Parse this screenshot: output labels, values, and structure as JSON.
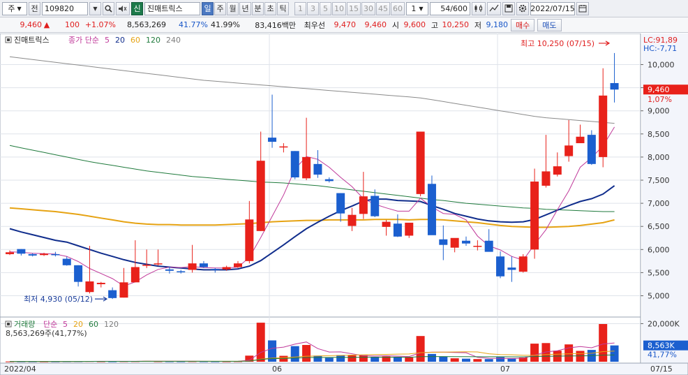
{
  "toolbar": {
    "market": "주",
    "type": "전",
    "code": "109820",
    "badge": "신",
    "name": "진매트릭스",
    "periods": [
      "일",
      "주",
      "월",
      "년",
      "분",
      "초",
      "틱"
    ],
    "active_period": "일",
    "intervals": [
      "1",
      "3",
      "5",
      "10",
      "15",
      "30",
      "45",
      "60"
    ],
    "custom_interval": "1",
    "count": "54/600",
    "date": "2022/07/15"
  },
  "quote": {
    "price": "9,460",
    "arrow": "▲",
    "change": "100",
    "change_pct": "+1.07%",
    "volume": "8,563,269",
    "vol_ratio": "41.77%",
    "turnover": "41.99%",
    "amount": "83,416백만",
    "best_label": "최우선",
    "ask": "9,470",
    "bid": "9,460",
    "open_label": "시",
    "open": "9,600",
    "high_label": "고",
    "high": "10,250",
    "low_label": "저",
    "low": "9,180",
    "buy_label": "매수",
    "sell_label": "매도"
  },
  "legend_price": {
    "name": "진매트릭스",
    "indicator": "종가 단순",
    "ma": [
      {
        "label": "5",
        "color": "#c0399a"
      },
      {
        "label": "20",
        "color": "#102d8c"
      },
      {
        "label": "60",
        "color": "#e6a313"
      },
      {
        "label": "120",
        "color": "#1f7a3c"
      },
      {
        "label": "240",
        "color": "#7d7d7d"
      }
    ]
  },
  "legend_volume": {
    "name": "거래량",
    "indicator": "단순",
    "ma": [
      {
        "label": "5",
        "color": "#c0399a"
      },
      {
        "label": "20",
        "color": "#e6a313"
      },
      {
        "label": "60",
        "color": "#1f7a3c"
      },
      {
        "label": "120",
        "color": "#7d7d7d"
      }
    ],
    "current": "8,563,269주(41,77%)"
  },
  "right_info": {
    "lc": "LC:91,89",
    "hc": "HC:-7,71",
    "price_tag": "9,460",
    "pct_tag": "1,07%",
    "vol_tag": "8,563K",
    "vol_pct": "41,77%"
  },
  "annotations": {
    "high": "최고 10,250 (07/15)",
    "low": "최저 4,930 (05/12)"
  },
  "colors": {
    "up": "#e8211a",
    "down": "#1b5fcf",
    "grid": "#dfe3ea",
    "panel_bg": "#ffffff"
  },
  "chart_data": {
    "type": "candlestick",
    "price_axis": {
      "min": 4600,
      "max": 10400,
      "ticks": [
        5000,
        5500,
        6000,
        6500,
        7000,
        7500,
        8000,
        8500,
        9000,
        9500,
        10000
      ],
      "tick_labels": [
        "5,000",
        "5,500",
        "6,000",
        "6,500",
        "7,000",
        "7,500",
        "8,000",
        "8,500",
        "9,000",
        "9,500",
        "10,000"
      ]
    },
    "volume_axis": {
      "max": 22000,
      "ticks": [
        20000
      ],
      "tick_labels": [
        "20,000K"
      ]
    },
    "x_labels": [
      {
        "index": 0,
        "label": "2022/04"
      },
      {
        "index": 23,
        "label": "06"
      },
      {
        "index": 43,
        "label": "07"
      }
    ],
    "last_label": "07/15",
    "ohlc": [
      [
        5900,
        5980,
        5880,
        5940
      ],
      [
        6010,
        6010,
        5870,
        5910
      ],
      [
        5900,
        5920,
        5850,
        5870
      ],
      [
        5880,
        5930,
        5860,
        5910
      ],
      [
        5900,
        5950,
        5850,
        5880
      ],
      [
        5800,
        5850,
        5650,
        5660
      ],
      [
        5660,
        5660,
        5200,
        5300
      ],
      [
        5080,
        6080,
        5050,
        5310
      ],
      [
        5250,
        5300,
        5180,
        5280
      ],
      [
        5120,
        5180,
        4930,
        4950
      ],
      [
        4960,
        5600,
        4960,
        5290
      ],
      [
        5290,
        6200,
        5290,
        5620
      ],
      [
        5650,
        6000,
        5600,
        5670
      ],
      [
        5680,
        6000,
        5650,
        5700
      ],
      [
        5570,
        5630,
        5480,
        5540
      ],
      [
        5530,
        5560,
        5480,
        5520
      ],
      [
        5560,
        6100,
        5500,
        5700
      ],
      [
        5700,
        5750,
        5600,
        5620
      ],
      [
        5580,
        5600,
        5500,
        5560
      ],
      [
        5570,
        5650,
        5540,
        5620
      ],
      [
        5620,
        5750,
        5600,
        5700
      ],
      [
        5750,
        7050,
        5700,
        6650
      ],
      [
        6400,
        8550,
        6400,
        7920
      ],
      [
        8420,
        9350,
        8200,
        8330
      ],
      [
        8230,
        8300,
        8100,
        8230
      ],
      [
        8130,
        8130,
        7520,
        7560
      ],
      [
        7540,
        8850,
        7500,
        8000
      ],
      [
        7850,
        8150,
        7550,
        7620
      ],
      [
        7520,
        7560,
        7450,
        7480
      ],
      [
        7220,
        7220,
        6600,
        6780
      ],
      [
        6510,
        6900,
        6400,
        6750
      ],
      [
        6770,
        7680,
        6660,
        7150
      ],
      [
        7160,
        7300,
        6700,
        6720
      ],
      [
        6490,
        6640,
        6300,
        6600
      ],
      [
        6560,
        6760,
        6270,
        6280
      ],
      [
        6300,
        6560,
        6250,
        6580
      ],
      [
        7200,
        8550,
        7150,
        8550
      ],
      [
        7420,
        7600,
        6320,
        6310
      ],
      [
        6220,
        6520,
        5770,
        6100
      ],
      [
        6040,
        6240,
        5940,
        6250
      ],
      [
        6190,
        6280,
        6080,
        6130
      ],
      [
        6060,
        6200,
        5980,
        6080
      ],
      [
        6190,
        6440,
        6050,
        5950
      ],
      [
        5850,
        5960,
        5380,
        5420
      ],
      [
        5610,
        5850,
        5300,
        5560
      ],
      [
        5520,
        5900,
        5500,
        5850
      ],
      [
        6000,
        7750,
        5800,
        7470
      ],
      [
        7380,
        8480,
        7340,
        7690
      ],
      [
        7620,
        8100,
        7580,
        7800
      ],
      [
        8020,
        8800,
        7900,
        8250
      ],
      [
        8300,
        8700,
        8300,
        8440
      ],
      [
        8480,
        8580,
        7830,
        7850
      ],
      [
        8000,
        9920,
        7780,
        9330
      ],
      [
        9600,
        10250,
        9180,
        9460
      ]
    ],
    "volume": [
      150,
      140,
      130,
      120,
      130,
      180,
      220,
      300,
      200,
      180,
      250,
      260,
      400,
      220,
      200,
      180,
      240,
      200,
      180,
      190,
      230,
      3200,
      20500,
      11200,
      3100,
      8200,
      8800,
      3200,
      2100,
      3500,
      3300,
      3400,
      2600,
      2800,
      2600,
      2200,
      13500,
      4100,
      2700,
      1800,
      1600,
      1400,
      1400,
      2400,
      1700,
      2200,
      9500,
      9800,
      5800,
      9100,
      5700,
      6200,
      19800,
      8560
    ],
    "ma": {
      "5": [
        5950,
        5940,
        5920,
        5910,
        5900,
        5850,
        5740,
        5590,
        5480,
        5370,
        5210,
        5300,
        5450,
        5570,
        5620,
        5610,
        5630,
        5610,
        5600,
        5600,
        5620,
        5830,
        6260,
        6720,
        7180,
        7740,
        8010,
        7950,
        7780,
        7560,
        7360,
        7100,
        6980,
        6900,
        6830,
        6830,
        7110,
        6920,
        6780,
        6760,
        6640,
        6290,
        6080,
        5990,
        5850,
        5770,
        6110,
        6430,
        6860,
        7270,
        7780,
        7990,
        8240,
        8650
      ],
      "20": [
        6450,
        6380,
        6320,
        6260,
        6200,
        6160,
        6080,
        6000,
        5920,
        5850,
        5780,
        5720,
        5680,
        5640,
        5620,
        5600,
        5580,
        5560,
        5560,
        5560,
        5580,
        5640,
        5760,
        5930,
        6100,
        6280,
        6450,
        6590,
        6720,
        6840,
        6940,
        7050,
        7090,
        7090,
        7060,
        7050,
        7040,
        6950,
        6870,
        6780,
        6720,
        6660,
        6620,
        6600,
        6590,
        6600,
        6650,
        6750,
        6850,
        6950,
        7040,
        7100,
        7200,
        7380
      ],
      "60": [
        6900,
        6880,
        6860,
        6840,
        6820,
        6790,
        6760,
        6720,
        6680,
        6640,
        6600,
        6570,
        6550,
        6540,
        6540,
        6530,
        6530,
        6530,
        6530,
        6540,
        6550,
        6560,
        6580,
        6600,
        6610,
        6620,
        6630,
        6630,
        6640,
        6640,
        6640,
        6640,
        6650,
        6650,
        6650,
        6640,
        6650,
        6650,
        6640,
        6620,
        6600,
        6580,
        6550,
        6520,
        6500,
        6490,
        6480,
        6480,
        6490,
        6500,
        6520,
        6550,
        6580,
        6640
      ],
      "120": [
        8250,
        8200,
        8150,
        8100,
        8050,
        8000,
        7950,
        7900,
        7860,
        7820,
        7780,
        7740,
        7700,
        7670,
        7640,
        7610,
        7580,
        7560,
        7540,
        7520,
        7500,
        7480,
        7460,
        7450,
        7440,
        7420,
        7400,
        7380,
        7350,
        7320,
        7290,
        7260,
        7230,
        7200,
        7170,
        7140,
        7110,
        7080,
        7060,
        7030,
        7000,
        6980,
        6960,
        6940,
        6920,
        6900,
        6890,
        6870,
        6860,
        6850,
        6840,
        6830,
        6820,
        6820
      ],
      "240": [
        10170,
        10140,
        10110,
        10080,
        10050,
        10020,
        9990,
        9960,
        9930,
        9900,
        9870,
        9840,
        9810,
        9780,
        9750,
        9720,
        9690,
        9660,
        9640,
        9620,
        9600,
        9580,
        9560,
        9540,
        9520,
        9500,
        9480,
        9460,
        9440,
        9420,
        9400,
        9380,
        9360,
        9340,
        9320,
        9300,
        9280,
        9240,
        9200,
        9160,
        9120,
        9080,
        9040,
        9000,
        8960,
        8920,
        8880,
        8850,
        8830,
        8810,
        8790,
        8770,
        8750,
        8730
      ]
    }
  }
}
